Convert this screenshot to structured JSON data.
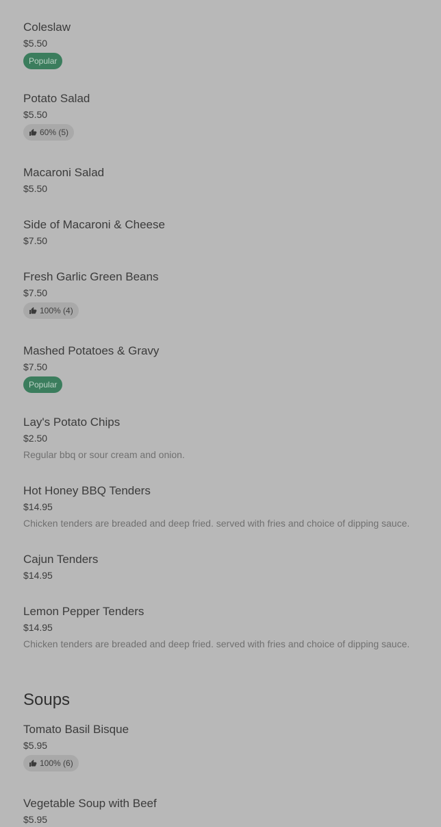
{
  "menu": {
    "items_before_soups": [
      {
        "name": "Coleslaw",
        "price": "$5.50",
        "badge": "Popular"
      },
      {
        "name": "Potato Salad",
        "price": "$5.50",
        "rating": "60% (5)"
      },
      {
        "name": "Macaroni Salad",
        "price": "$5.50"
      },
      {
        "name": "Side of Macaroni & Cheese",
        "price": "$7.50"
      },
      {
        "name": "Fresh Garlic Green Beans",
        "price": "$7.50",
        "rating": "100% (4)"
      },
      {
        "name": "Mashed Potatoes & Gravy",
        "price": "$7.50",
        "badge": "Popular"
      },
      {
        "name": "Lay's Potato Chips",
        "price": "$2.50",
        "description": "Regular bbq or sour cream and onion."
      },
      {
        "name": "Hot Honey BBQ Tenders",
        "price": "$14.95",
        "description": "Chicken tenders are breaded and deep fried. served with fries and choice of dipping sauce."
      },
      {
        "name": "Cajun Tenders",
        "price": "$14.95"
      },
      {
        "name": "Lemon Pepper Tenders",
        "price": "$14.95",
        "description": "Chicken tenders are breaded and deep fried. served with fries and choice of dipping sauce."
      }
    ],
    "soups_title": "Soups",
    "soups": [
      {
        "name": "Tomato Basil Bisque",
        "price": "$5.95",
        "rating": "100% (6)"
      },
      {
        "name": "Vegetable Soup with Beef",
        "price": "$5.95"
      }
    ]
  },
  "colors": {
    "background": "#b8b8b8",
    "popular_badge": "#3b7d5d",
    "rating_badge": "#a9a9a9"
  },
  "icons": {
    "rating": "thumbs-up-icon"
  }
}
